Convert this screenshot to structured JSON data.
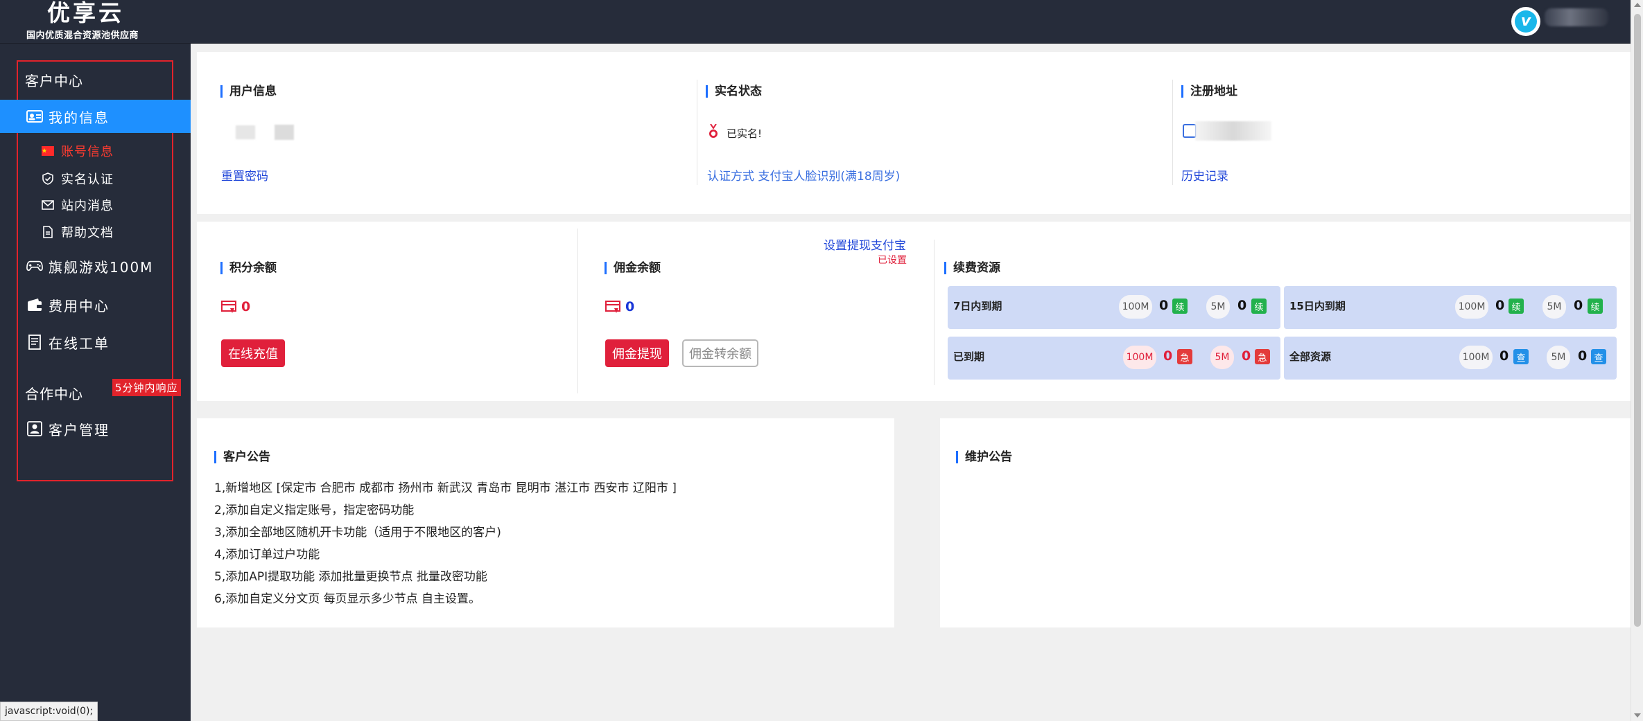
{
  "header": {
    "logo_title": "优享云",
    "logo_subtitle": "国内优质混合资源池供应商"
  },
  "sidebar": {
    "customer_center": "客户中心",
    "my_info": "我的信息",
    "sub_items": [
      "账号信息",
      "实名认证",
      "站内消息",
      "帮助文档"
    ],
    "flagship_game": "旗舰游戏100M",
    "billing_center": "费用中心",
    "online_ticket": "在线工单",
    "ticket_badge": "5分钟内响应",
    "partner_center": "合作中心",
    "customer_mgmt": "客户管理"
  },
  "user_info": {
    "title": "用户信息",
    "reset_password": "重置密码"
  },
  "realname": {
    "title": "实名状态",
    "status": "已实名!",
    "method": "认证方式 支付宝人脸识别(满18周岁)"
  },
  "register": {
    "title": "注册地址",
    "history": "历史记录"
  },
  "points": {
    "title": "积分余额",
    "value": "0",
    "recharge_btn": "在线充值"
  },
  "commission": {
    "title": "佣金余额",
    "value": "0",
    "withdraw_btn": "佣金提现",
    "transfer_btn": "佣金转余额",
    "alipay_link": "设置提现支付宝",
    "alipay_status": "已设置"
  },
  "renewal": {
    "title": "续费资源",
    "tiles": [
      {
        "label": "7日内到期",
        "a_size": "100M",
        "a_count": "0",
        "a_tag": "续",
        "b_size": "5M",
        "b_count": "0",
        "b_tag": "续"
      },
      {
        "label": "15日内到期",
        "a_size": "100M",
        "a_count": "0",
        "a_tag": "续",
        "b_size": "5M",
        "b_count": "0",
        "b_tag": "续"
      },
      {
        "label": "已到期",
        "a_size": "100M",
        "a_count": "0",
        "a_tag": "急",
        "b_size": "5M",
        "b_count": "0",
        "b_tag": "急"
      },
      {
        "label": "全部资源",
        "a_size": "100M",
        "a_count": "0",
        "a_tag": "查",
        "b_size": "5M",
        "b_count": "0",
        "b_tag": "查"
      }
    ]
  },
  "customer_notice": {
    "title": "客户公告",
    "lines": [
      "1,新增地区 [保定市 合肥市 成都市 扬州市 新武汉 青岛市 昆明市 湛江市 西安市 辽阳市 ]",
      "2,添加自定义指定账号，指定密码功能",
      "3,添加全部地区随机开卡功能（适用于不限地区的客户)",
      "4,添加订单过户功能",
      "5,添加API提取功能 添加批量更换节点 批量改密功能",
      "6,添加自定义分文页 每页显示多少节点 自主设置。"
    ]
  },
  "maintenance_notice": {
    "title": "维护公告"
  },
  "statusbar": {
    "text": "javascript:void(0);"
  },
  "colors": {
    "header_bg": "#262c3a",
    "active_blue": "#1e90ff",
    "accent_red": "#e0203b",
    "link_blue": "#2147d9",
    "tile_bg": "#cfdaf6"
  }
}
